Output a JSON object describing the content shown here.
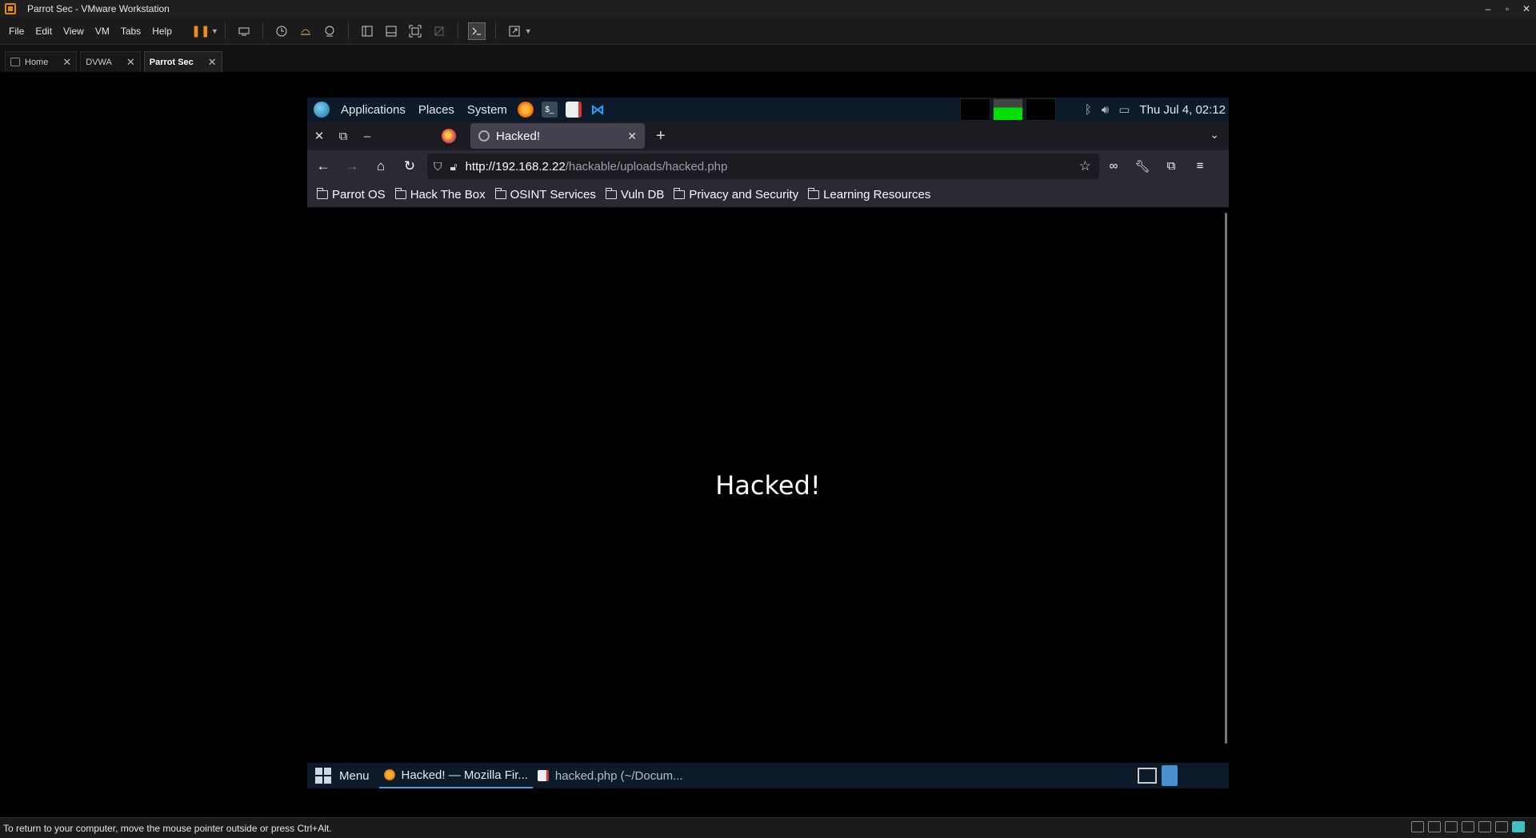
{
  "host": {
    "window_title": "Parrot Sec - VMware Workstation",
    "window_controls": [
      "–",
      "▫",
      "✕"
    ],
    "menus": [
      "File",
      "Edit",
      "View",
      "VM",
      "Tabs",
      "Help"
    ],
    "tabs": [
      {
        "label": "Home",
        "close": "✕"
      },
      {
        "label": "DVWA",
        "close": "✕"
      },
      {
        "label": "Parrot Sec",
        "close": "✕"
      }
    ],
    "status_text": "To return to your computer, move the mouse pointer outside or press Ctrl+Alt."
  },
  "guest": {
    "top_panel": {
      "menus": [
        "Applications",
        "Places",
        "System"
      ],
      "quick_launch": [
        "firefox-icon",
        "terminal-icon",
        "text-editor-icon",
        "vscode-icon"
      ],
      "terminal_glyph": "$_",
      "vscode_glyph": "⋈",
      "clock": "Thu Jul 4, 02:12"
    },
    "firefox": {
      "tab_title": "Hacked!",
      "tab_close": "✕",
      "new_tab": "+",
      "list_tabs": "⌄",
      "url_host": "http://192.168.2.22",
      "url_path": "/hackable/uploads/hacked.php",
      "bookmarks": [
        "Parrot OS",
        "Hack The Box",
        "OSINT Services",
        "Vuln DB",
        "Privacy and Security",
        "Learning Resources"
      ],
      "page_heading": "Hacked!"
    },
    "bottom_panel": {
      "menu_label": "Menu",
      "tasks": [
        {
          "label": "Hacked! — Mozilla Fir...",
          "active": true
        },
        {
          "label": "hacked.php (~/Docum...",
          "active": false
        }
      ]
    }
  },
  "colors": {
    "panel_bg": "#0c1a2a",
    "firefox_toolbar": "#2b2a33",
    "firefox_tabstrip": "#1c1b22",
    "pause_orange": "#f28a1c",
    "workspace_green": "#00e000"
  }
}
